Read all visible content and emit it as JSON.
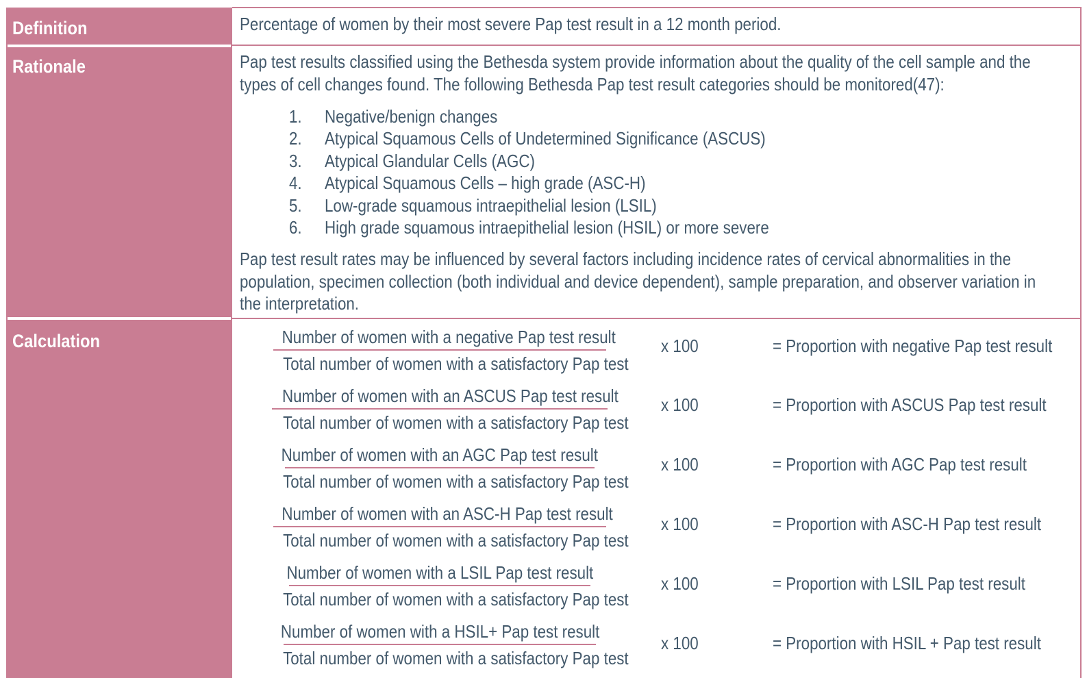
{
  "colors": {
    "accent": "#c97d93",
    "text": "#43596b",
    "label_text": "#ffffff"
  },
  "rows": {
    "definition": {
      "label": "Definition",
      "text": "Percentage of women by their most severe Pap test result in a 12 month period."
    },
    "rationale": {
      "label": "Rationale",
      "intro_lines": [
        "Pap test results classified using the Bethesda system provide information about the quality of the cell sample and the",
        "types of cell changes found.  The following Bethesda Pap test result categories should be monitored(47):"
      ],
      "list": [
        {
          "num": "1.",
          "text": "Negative/benign changes"
        },
        {
          "num": "2.",
          "text": "Atypical Squamous Cells of Undetermined Significance (ASCUS)"
        },
        {
          "num": "3.",
          "text": "Atypical Glandular Cells (AGC)"
        },
        {
          "num": "4.",
          "text": "Atypical Squamous Cells – high grade (ASC-H)"
        },
        {
          "num": "5.",
          "text": "Low-grade squamous intraepithelial lesion (LSIL)"
        },
        {
          "num": "6.",
          "text": "High grade squamous intraepithelial lesion (HSIL) or more severe"
        }
      ],
      "closing_lines": [
        "Pap test result rates may be influenced by several factors including incidence rates of cervical abnormalities in the",
        "population, specimen collection (both individual and device dependent), sample preparation, and observer variation in",
        "the interpretation."
      ]
    },
    "calculation": {
      "label": "Calculation",
      "formulas": [
        {
          "numerator": "Number of women with a negative Pap test result",
          "denominator": "Total number of women with a satisfactory Pap test",
          "multiplier": "x 100",
          "result": "= Proportion with negative Pap test result"
        },
        {
          "numerator": "Number of women with an ASCUS Pap test result",
          "denominator": "Total number of women with a satisfactory Pap test",
          "multiplier": "x 100",
          "result": "= Proportion with ASCUS Pap test result"
        },
        {
          "numerator": "Number of women with an AGC Pap test result",
          "denominator": "Total number of women with a satisfactory Pap test",
          "multiplier": "x 100",
          "result": "= Proportion with AGC Pap test result"
        },
        {
          "numerator": "Number of women with an ASC-H Pap test result",
          "denominator": "Total number of women with a satisfactory Pap test",
          "multiplier": "x 100",
          "result": "= Proportion with ASC-H Pap test result"
        },
        {
          "numerator": "Number of women with a LSIL Pap test result",
          "denominator": "Total number of women with a satisfactory Pap test",
          "multiplier": "x 100",
          "result": "= Proportion with LSIL Pap test result"
        },
        {
          "numerator": "Number of women with a HSIL+ Pap test result",
          "denominator": "Total number of women with a satisfactory Pap test",
          "multiplier": "x 100",
          "result": "= Proportion with HSIL +  Pap test result"
        }
      ]
    }
  }
}
